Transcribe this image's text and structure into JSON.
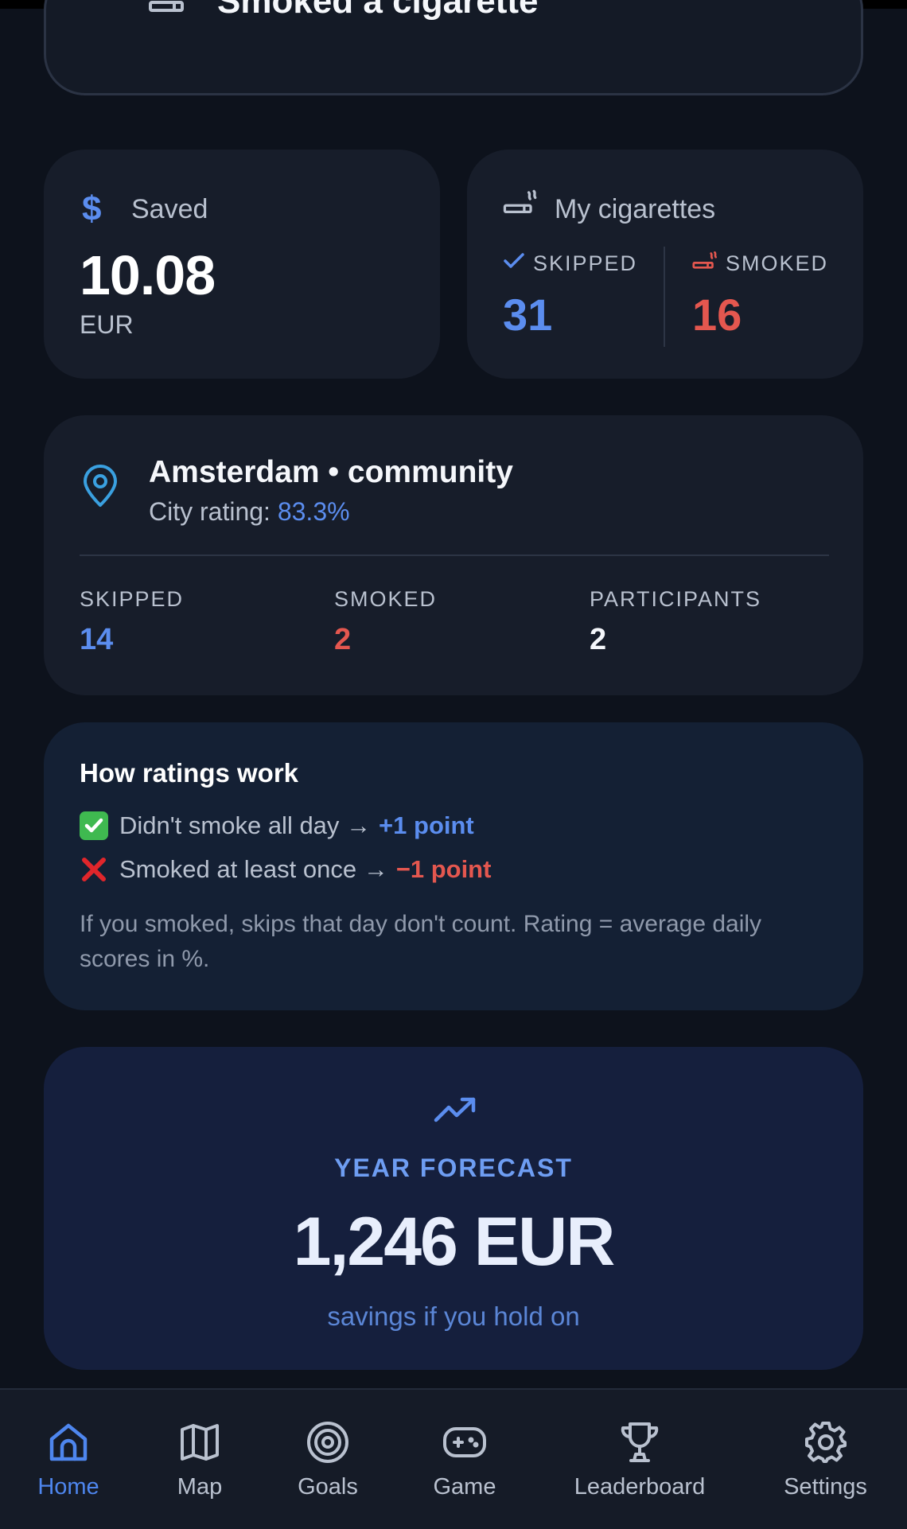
{
  "action": {
    "label": "Smoked a cigarette",
    "icon": "cigarette-icon"
  },
  "saved": {
    "label": "Saved",
    "value": "10.08",
    "currency": "EUR",
    "icon": "dollar-icon"
  },
  "cigarettes": {
    "title": "My cigarettes",
    "skipped_label": "SKIPPED",
    "skipped_value": "31",
    "smoked_label": "SMOKED",
    "smoked_value": "16"
  },
  "city": {
    "name": "Amsterdam • community",
    "rating_label": "City rating:",
    "rating_value": "83.3%",
    "stats": [
      {
        "label": "SKIPPED",
        "value": "14",
        "color": "#5b8def"
      },
      {
        "label": "SMOKED",
        "value": "2",
        "color": "#e4574f"
      },
      {
        "label": "PARTICIPANTS",
        "value": "2",
        "color": "#f5f7fb"
      }
    ]
  },
  "how_ratings": {
    "title": "How ratings work",
    "rule1_text": "Didn't smoke all day →",
    "rule1_points": "+1 point",
    "rule2_text": "Smoked at least once →",
    "rule2_points": "−1 point",
    "note": "If you smoked, skips that day don't count. Rating = average daily scores in %."
  },
  "forecast": {
    "label": "YEAR FORECAST",
    "amount": "1,246 EUR",
    "subtitle": "savings if you hold on"
  },
  "nav": {
    "items": [
      {
        "label": "Home",
        "icon": "home-icon",
        "active": true
      },
      {
        "label": "Map",
        "icon": "map-icon",
        "active": false
      },
      {
        "label": "Goals",
        "icon": "target-icon",
        "active": false
      },
      {
        "label": "Game",
        "icon": "gamepad-icon",
        "active": false
      },
      {
        "label": "Leaderboard",
        "icon": "trophy-icon",
        "active": false
      },
      {
        "label": "Settings",
        "icon": "gear-icon",
        "active": false
      }
    ]
  },
  "colors": {
    "accent": "#5b8def",
    "danger": "#e4574f",
    "background": "#0d121c",
    "card": "#171d2a"
  }
}
